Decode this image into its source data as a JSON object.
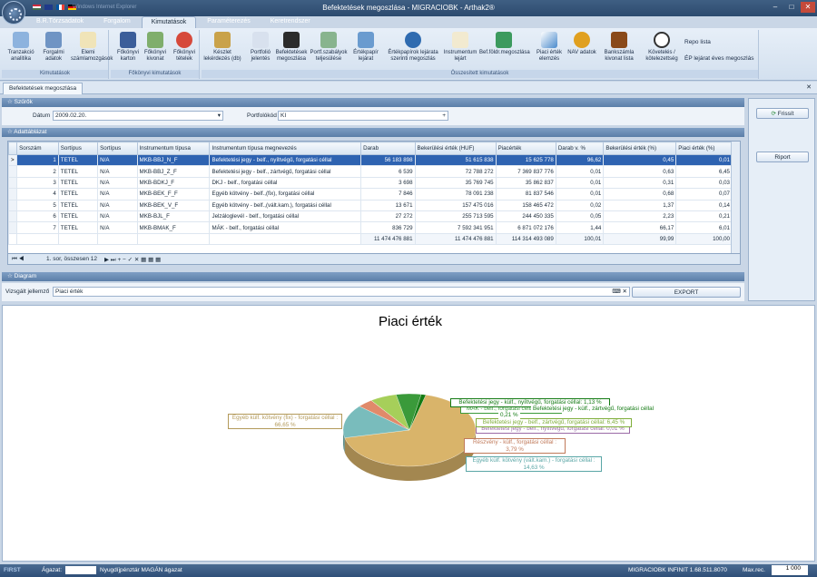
{
  "window": {
    "title": "Befektetések megoszlása - MIGRACIOBK - Arthak2®",
    "faded_title": "Windows Internet Explorer"
  },
  "tabs": [
    "B.R.Törzsadatok",
    "Forgalom",
    "Kimutatások",
    "Paraméterezés",
    "Keretrendszer"
  ],
  "ribbon": {
    "groups": [
      {
        "label": "Kimutatások",
        "buttons": [
          "Tranzakció analitika",
          "Forgalmi adatok",
          "Elemi számlamozgások"
        ]
      },
      {
        "label": "Főkönyvi kimutatások",
        "buttons": [
          "Főkönyvi karton",
          "Főkönyvi kivonat",
          "Főkönyvi tételek"
        ]
      },
      {
        "label": "Összesített kimutatások",
        "buttons": [
          "Készlet lekérdezés (db)",
          "Portfolió jelentés",
          "Befektetések megoszlása",
          "Portf.szabályok teljesülése",
          "Értékpapír lejárat",
          "Értékpapírok lejárata szerinti megoszlás",
          "Instrumentum lejárt",
          "Bef.földr.megoszlása",
          "Piaci érték elemzés",
          "NAV adatok",
          "Bankszámla kivonat lista",
          "Követelés / kötelezettség"
        ]
      }
    ],
    "links": [
      "Repo lista",
      "ÉP lejárat éves megoszlás"
    ]
  },
  "doc_tab": "Befektetések megoszlása",
  "sections": {
    "filters": "Szűrők",
    "table": "Adattáblázat",
    "diagram": "Diagram"
  },
  "filters": {
    "date_label": "Dátum",
    "date_value": "2009.02.20.",
    "portfolio_label": "Portfolókód",
    "portfolio_value": "KI"
  },
  "buttons": {
    "refresh": "Frissít",
    "report": "Riport",
    "export": "EXPORT"
  },
  "grid": {
    "columns": [
      "Sorszám",
      "Sortípus",
      "Sortípus",
      "Instrumentum típusa",
      "Instrumentum típusa megnevezés",
      "Darab",
      "Bekerülési érték (HUF)",
      "Piacérték",
      "Darab v. %",
      "Bekerülési érték (%)",
      "Piaci érték (%)"
    ],
    "rows": [
      [
        "1",
        "TETEL",
        "N/A",
        "MKB-BBJ_N_F",
        "Befektetési jegy - belf., nyíltvégű, forgatási céllal",
        "56 183 898",
        "51 615 838",
        "15 625 778",
        "96,62",
        "0,45",
        "0,01"
      ],
      [
        "2",
        "TETEL",
        "N/A",
        "MKB-BBJ_Z_F",
        "Befektetési jegy - belf., zártvégű, forgatási céllal",
        "6 539",
        "72 788 272",
        "7 369 837 776",
        "0,01",
        "0,63",
        "6,45"
      ],
      [
        "3",
        "TETEL",
        "N/A",
        "MKB-BDKJ_F",
        "DKJ - belf., forgatási céllal",
        "3 698",
        "35 769 745",
        "35 862 837",
        "0,01",
        "0,31",
        "0,03"
      ],
      [
        "4",
        "TETEL",
        "N/A",
        "MKB-BEK_F_F",
        "Egyéb kötvény - belf.,(fix), forgatási céllal",
        "7 846",
        "78 091 238",
        "81 837 546",
        "0,01",
        "0,68",
        "0,07"
      ],
      [
        "5",
        "TETEL",
        "N/A",
        "MKB-BEK_V_F",
        "Egyéb kötvény - belf.,(vált.kam.), forgatási céllal",
        "13 671",
        "157 475 016",
        "158 465 472",
        "0,02",
        "1,37",
        "0,14"
      ],
      [
        "6",
        "TETEL",
        "N/A",
        "MKB-BJL_F",
        "Jelzáloglevél - belf., forgatási céllal",
        "27 272",
        "255 713 595",
        "244 450 335",
        "0,05",
        "2,23",
        "0,21"
      ],
      [
        "7",
        "TETEL",
        "N/A",
        "MKB-BMAK_F",
        "MÁK - belf., forgatási céllal",
        "836 729",
        "7 592 341 951",
        "6 871 072 176",
        "1,44",
        "66,17",
        "6,01"
      ]
    ],
    "totals": [
      "11 474 476 881",
      "11 474 476 881",
      "114 314 493 089",
      "100,01",
      "99,99",
      "100,00"
    ],
    "footer": "1. sor, összesen 12"
  },
  "diagram": {
    "label": "Vizsgált jellemző",
    "value": "Piaci érték"
  },
  "chart_data": {
    "type": "pie",
    "title": "Piaci érték",
    "slices": [
      {
        "label": "Egyéb külf. kötvény (fix) - forgatási céllal : 66,65 %",
        "value": 66.65,
        "color": "#d9b46a"
      },
      {
        "label": "Egyéb külf. kötvény (vált.kam.) - forgatási céllal : 14,63 %",
        "value": 14.63,
        "color": "#79bcbc"
      },
      {
        "label": "Részvény - külf., forgatási céllal : 3,79 %",
        "value": 3.79,
        "color": "#e08a6a"
      },
      {
        "label": "Befektetési jegy - belf., nyíltvégű, forgatási céllal: 0,01 %",
        "value": 0.01,
        "color": "#b87fc0"
      },
      {
        "label": "Befektetési jegy - belf., zártvégű, forgatási céllal: 6,45 %",
        "value": 6.45,
        "color": "#a6cf5a"
      },
      {
        "label": "MÁK - belf., forgatási céllal: 6,01 %",
        "value": 6.01,
        "color": "#3a9a3a"
      },
      {
        "label": "Befektetési jegy - külf., nyíltvégű, forgatási céllal: 1,13 %",
        "value": 1.13,
        "color": "#137a13"
      }
    ],
    "extra_labels": [
      "Befektetési jegy - külf., zártvégű, forgatási céllal",
      "0,21 %"
    ]
  },
  "status": {
    "agazat_label": "Ágazat:",
    "agazat_value": "Nyugdíjpénztár MAGÁN ágazat",
    "server": "MIGRACIOBK INFINIT 1.68.511.8070",
    "max_label": "Max.rec.",
    "max_value": "1 000",
    "brand": "FIRST"
  }
}
